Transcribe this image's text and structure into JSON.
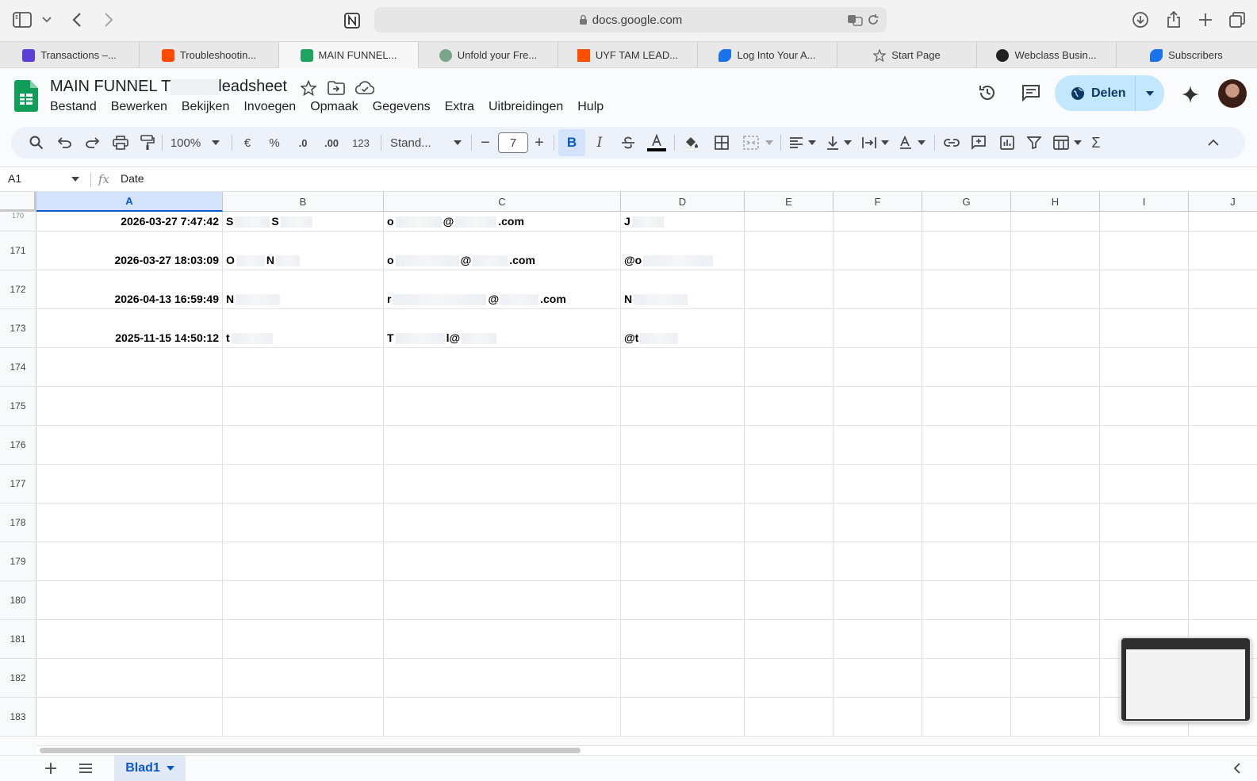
{
  "browser": {
    "url": "docs.google.com",
    "tabs": [
      {
        "label": "Transactions –...",
        "fav_color": "#5b3fd6"
      },
      {
        "label": "Troubleshootin...",
        "fav_color": "#ff4a00"
      },
      {
        "label": "MAIN FUNNEL...",
        "fav_color": "#1ea362"
      },
      {
        "label": "Unfold your Fre...",
        "fav_color": "#7aa58b"
      },
      {
        "label": "UYF TAM LEAD...",
        "fav_color": "#ff4f00"
      },
      {
        "label": "Log Into Your A...",
        "fav_color": "#1a73e8"
      },
      {
        "label": "Start Page",
        "fav_color": "#666666"
      },
      {
        "label": "Webclass Busin...",
        "fav_color": "#222222"
      },
      {
        "label": "Subscribers",
        "fav_color": "#1a73e8"
      }
    ]
  },
  "doc": {
    "title_start": "MAIN FUNNEL T",
    "title_end": "leadsheet",
    "menu": [
      "Bestand",
      "Bewerken",
      "Bekijken",
      "Invoegen",
      "Opmaak",
      "Gegevens",
      "Extra",
      "Uitbreidingen",
      "Hulp"
    ],
    "share_label": "Delen",
    "accent": "#c2e7ff"
  },
  "toolbar": {
    "zoom": "100%",
    "currency": "€",
    "percent": "%",
    "dec_less": ".0",
    "dec_more": ".00",
    "number_format": "123",
    "font": "Stand...",
    "font_size": "7",
    "bold": "B",
    "italic": "I",
    "sum": "Σ"
  },
  "formula_bar": {
    "cell_ref": "A1",
    "fx": "fx",
    "value": "Date"
  },
  "grid": {
    "columns": [
      "A",
      "B",
      "C",
      "D",
      "E",
      "F",
      "G",
      "H",
      "I",
      "J"
    ],
    "rows": [
      {
        "num": "170",
        "a": "2026-03-27 7:47:42",
        "b1": "S",
        "b2": "S",
        "c1": "o",
        "c2": "@",
        "c3": ".com",
        "d1": "J"
      },
      {
        "num": "171",
        "a": "2026-03-27 18:03:09",
        "b1": "O",
        "b2": "N",
        "c1": "o",
        "c2": "@",
        "c3": ".com",
        "d1": "@o"
      },
      {
        "num": "172",
        "a": "2026-04-13 16:59:49",
        "b1": "N",
        "b2": "",
        "c1": "r",
        "c2": "@",
        "c3": ".com",
        "d1": "N"
      },
      {
        "num": "173",
        "a": "2025-11-15 14:50:12",
        "b1": "t",
        "b2": "",
        "c1": "T",
        "c2": "l@",
        "c3": "",
        "d1": "@t"
      }
    ],
    "empty_rows": [
      "174",
      "175",
      "176",
      "177",
      "178",
      "179",
      "180",
      "181",
      "182",
      "183"
    ]
  },
  "sheets": {
    "active": "Blad1"
  }
}
